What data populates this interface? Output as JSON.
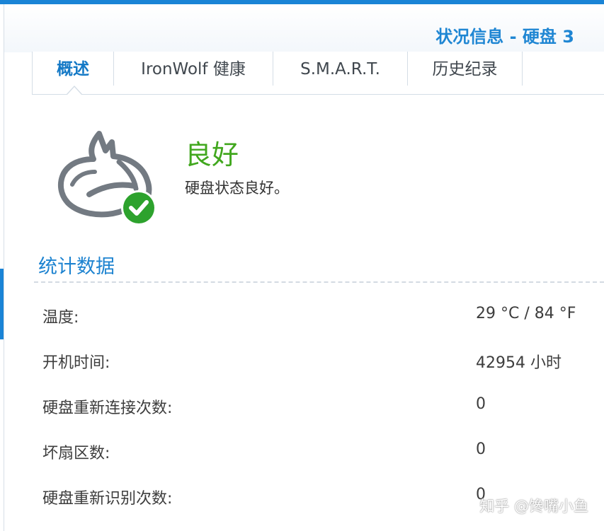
{
  "window": {
    "title": "状况信息 - 硬盘 3"
  },
  "tabs": [
    {
      "label": "概述",
      "active": true
    },
    {
      "label": "IronWolf 健康",
      "active": false
    },
    {
      "label": "S.M.A.R.T.",
      "active": false
    },
    {
      "label": "历史纪录",
      "active": false
    }
  ],
  "status": {
    "title": "良好",
    "description": "硬盘状态良好。",
    "icon": "ironwolf-logo-icon",
    "badge_icon": "check-icon",
    "color": "#41a71e"
  },
  "statistics": {
    "title": "统计数据",
    "rows": [
      {
        "label": "温度:",
        "value": "29 °C / 84 °F"
      },
      {
        "label": "开机时间:",
        "value": "42954 小时"
      },
      {
        "label": "硬盘重新连接次数:",
        "value": "0"
      },
      {
        "label": "坏扇区数:",
        "value": "0"
      },
      {
        "label": "硬盘重新识别次数:",
        "value": "0"
      }
    ]
  },
  "watermark": "知乎 @馋嘴小鱼",
  "colors": {
    "accent": "#1f86d3",
    "good": "#41a71e"
  }
}
